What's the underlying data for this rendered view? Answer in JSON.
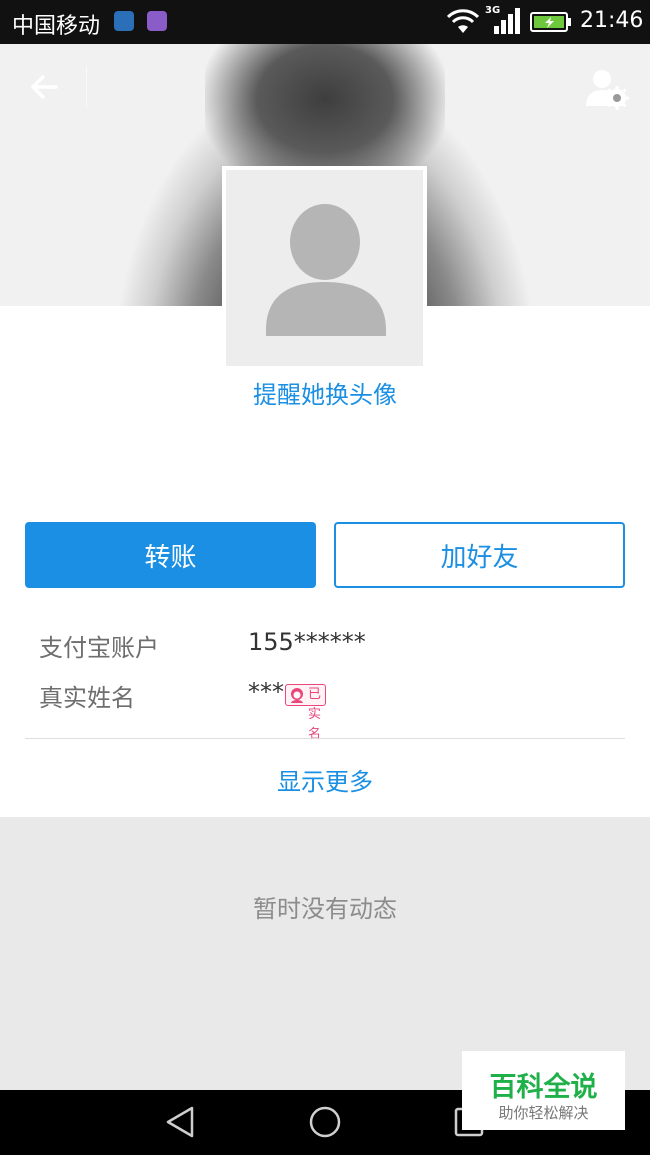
{
  "status_bar": {
    "carrier": "中国移动",
    "network_type": "3G",
    "time": "21:46"
  },
  "header": {
    "back_icon": "arrow-left-icon",
    "settings_icon": "user-settings-icon"
  },
  "profile": {
    "avatar_icon": "default-avatar-icon",
    "remind_avatar_link": "提醒她换头像"
  },
  "actions": {
    "transfer_label": "转账",
    "add_friend_label": "加好友"
  },
  "info": {
    "rows": [
      {
        "label": "支付宝账户",
        "value": "155******"
      },
      {
        "label": "真实姓名",
        "value": "***"
      }
    ],
    "verified_badge": "已实名",
    "show_more": "显示更多"
  },
  "feed": {
    "empty_text": "暂时没有动态"
  },
  "watermark": {
    "title": "百科全说",
    "subtitle": "助你轻松解决"
  },
  "colors": {
    "accent": "#1a8fe3",
    "badge": "#e8467c",
    "feed_bg": "#e9e9e9"
  }
}
